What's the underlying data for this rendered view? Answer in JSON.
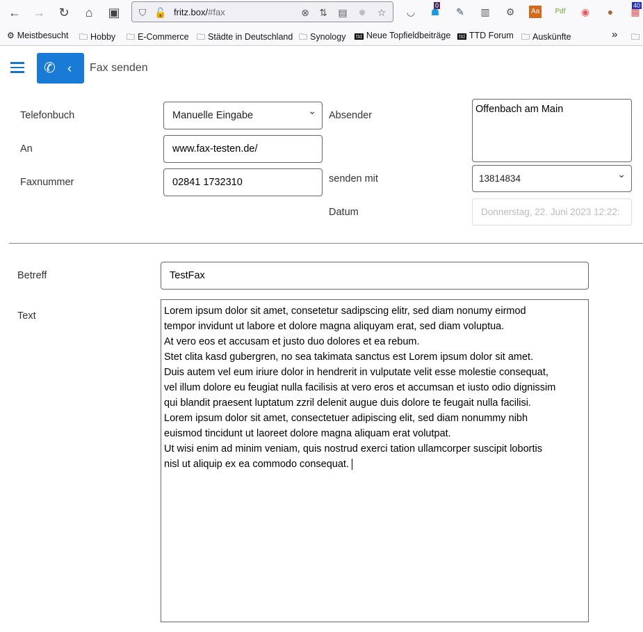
{
  "browser": {
    "url_host": "fritz.box/",
    "url_path": "#fax",
    "badges": {
      "ghost": "0",
      "extension": "40"
    },
    "bookmarks": [
      "Meistbesucht",
      "Hobby",
      "E-Commerce",
      "Städte in Deutschland",
      "Synology",
      "Neue Topfieldbeiträge",
      "TTD Forum",
      "Auskünfte"
    ]
  },
  "header": {
    "title": "Fax senden"
  },
  "form": {
    "phonebook_label": "Telefonbuch",
    "phonebook_value": "Manuelle Eingabe",
    "to_label": "An",
    "to_value": "www.fax-testen.de/",
    "faxnumber_label": "Faxnummer",
    "faxnumber_value": "02841 1732310",
    "sender_label": "Absender",
    "sender_value": "Offenbach am Main",
    "send_with_label": "senden mit",
    "send_with_value": "13814834",
    "date_label": "Datum",
    "date_placeholder": "Donnerstag, 22. Juni 2023 12:22:",
    "subject_label": "Betreff",
    "subject_value": "TestFax",
    "text_label": "Text",
    "text_lines": [
      "Lorem ipsum dolor sit amet, consetetur sadipscing elitr, sed diam nonumy eirmod",
      "tempor invidunt ut labore et dolore magna aliquyam erat, sed diam voluptua.",
      "At vero eos et accusam et justo duo dolores et ea rebum.",
      "Stet clita kasd gubergren, no sea takimata sanctus est Lorem ipsum dolor sit amet.",
      "Duis autem vel eum iriure dolor in hendrerit in vulputate velit esse molestie consequat,",
      "vel illum dolore eu feugiat nulla facilisis at vero eros et accumsan et iusto odio dignissim",
      "qui blandit praesent luptatum zzril delenit augue duis dolore te feugait nulla facilisi.",
      "Lorem ipsum dolor sit amet, consectetuer adipiscing elit, sed diam nonummy nibh",
      "euismod tincidunt ut laoreet dolore magna aliquam erat volutpat.",
      "Ut wisi enim ad minim veniam, quis nostrud exerci tation ullamcorper suscipit lobortis",
      "nisl ut aliquip ex ea commodo consequat."
    ]
  }
}
